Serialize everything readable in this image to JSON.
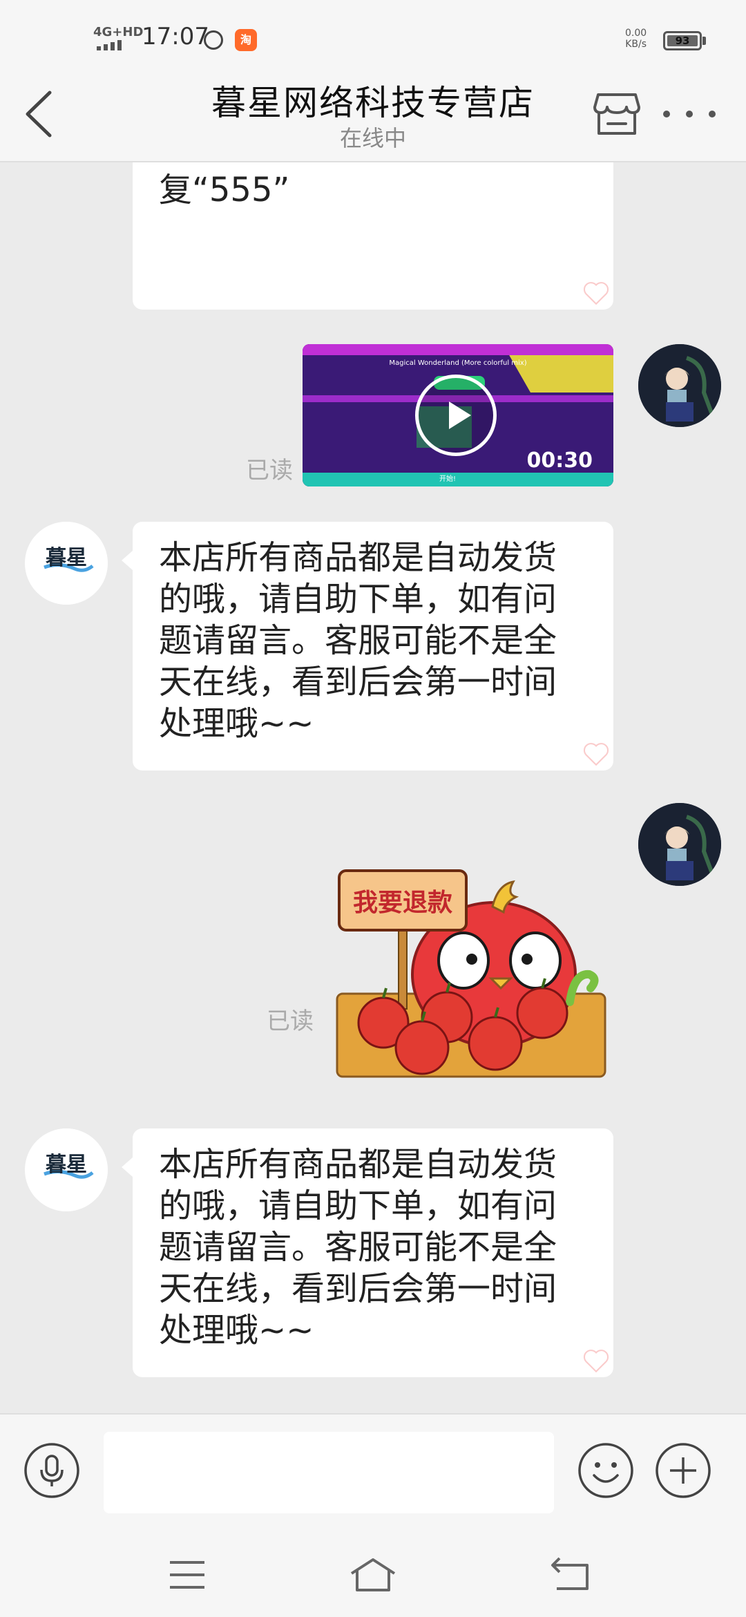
{
  "status_bar": {
    "network": "4G+HD",
    "time": "17:07",
    "hd_badge": "⑪",
    "app_badge": "淘",
    "speed_value": "0.00",
    "speed_unit": "KB/s",
    "battery": "93"
  },
  "header": {
    "title": "暮星网络科技专营店",
    "subtitle": "在线中"
  },
  "messages": {
    "partial_bubble_text": "复“555”",
    "video": {
      "duration": "00:30",
      "read_label": "已读"
    },
    "auto_reply_1": "本店所有商品都是自动发货的哦，请自助下单，如有问题请留言。客服可能不是全天在线，看到后会第一时间处理哦~~",
    "sticker": {
      "sign_text": "我要退款",
      "read_label": "已读"
    },
    "auto_reply_2": "本店所有商品都是自动发货的哦，请自助下单，如有问题请留言。客服可能不是全天在线，看到后会第一时间处理哦~~"
  },
  "shop_avatar_text": "暮星",
  "input": {
    "placeholder": ""
  },
  "colors": {
    "background": "#ebebeb",
    "bubble": "#ffffff",
    "read_text": "#aaaaaa",
    "sticker_bird": "#e8393b",
    "sticker_box": "#e3a33b"
  }
}
